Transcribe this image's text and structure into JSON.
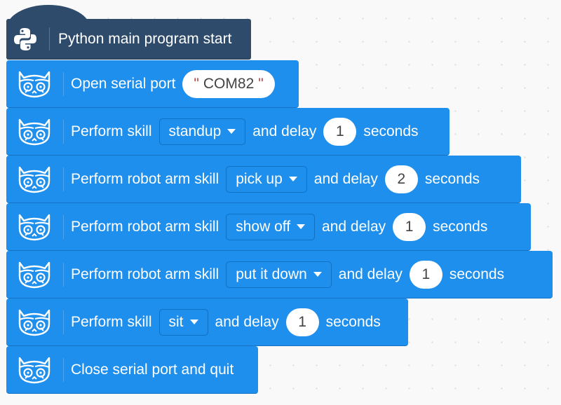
{
  "program": {
    "hat": {
      "label": "Python main program start",
      "icon": "python-logo-icon"
    },
    "block_icon": "robot-cat-icon",
    "blocks": [
      {
        "type": "open_serial",
        "label": "Open serial port",
        "port_value": "COM82"
      },
      {
        "type": "perform_skill",
        "label": "Perform skill",
        "skill": "standup",
        "and_delay": "and delay",
        "delay": "1",
        "unit": "seconds"
      },
      {
        "type": "perform_arm_skill",
        "label": "Perform robot arm skill",
        "skill": "pick up",
        "and_delay": "and delay",
        "delay": "2",
        "unit": "seconds"
      },
      {
        "type": "perform_arm_skill",
        "label": "Perform robot arm skill",
        "skill": "show off",
        "and_delay": "and delay",
        "delay": "1",
        "unit": "seconds"
      },
      {
        "type": "perform_arm_skill",
        "label": "Perform robot arm skill",
        "skill": "put it down",
        "and_delay": "and delay",
        "delay": "1",
        "unit": "seconds"
      },
      {
        "type": "perform_skill",
        "label": "Perform skill",
        "skill": "sit",
        "and_delay": "and delay",
        "delay": "1",
        "unit": "seconds"
      },
      {
        "type": "close_serial",
        "label": "Close serial port and quit"
      }
    ],
    "colors": {
      "hat_block": "#2e4b6b",
      "command_block": "#1e8fec",
      "string_quote": "#b94a48",
      "workspace": "#f9f9f9"
    }
  }
}
